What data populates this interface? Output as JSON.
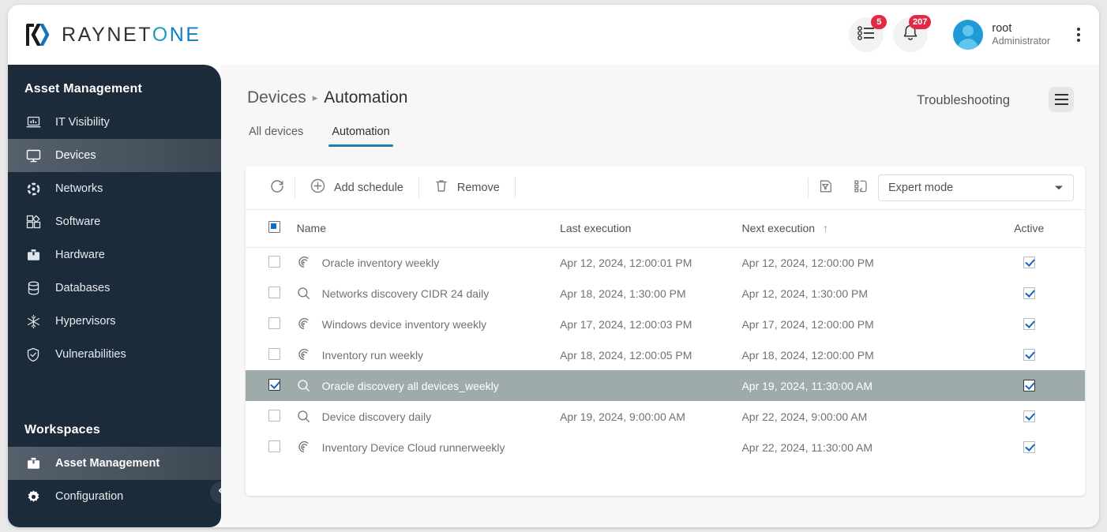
{
  "brand": {
    "name_dark": "RAYNET",
    "name_o": "O",
    "name_ne": "NE",
    "logo_icon": "raynet-logo-icon"
  },
  "topbar": {
    "tasks": {
      "icon": "task-list-icon",
      "badge": "5"
    },
    "notifications": {
      "icon": "bell-icon",
      "badge": "207"
    },
    "user": {
      "name": "root",
      "role": "Administrator",
      "avatar_icon": "user-avatar-icon"
    },
    "overflow_icon": "kebab-menu-icon"
  },
  "sidebar": {
    "section_title": "Asset Management",
    "items": [
      {
        "label": "IT Visibility",
        "icon": "laptop-chart-icon",
        "active": false
      },
      {
        "label": "Devices",
        "icon": "monitor-icon",
        "active": true
      },
      {
        "label": "Networks",
        "icon": "network-nodes-icon",
        "active": false
      },
      {
        "label": "Software",
        "icon": "software-blocks-icon",
        "active": false
      },
      {
        "label": "Hardware",
        "icon": "toolbox-icon",
        "active": false
      },
      {
        "label": "Databases",
        "icon": "database-icon",
        "active": false
      },
      {
        "label": "Hypervisors",
        "icon": "snowflake-icon",
        "active": false
      },
      {
        "label": "Vulnerabilities",
        "icon": "shield-check-icon",
        "active": false
      }
    ],
    "workspaces_title": "Workspaces",
    "workspaces": [
      {
        "label": "Asset Management",
        "icon": "briefcase-icon",
        "active": true
      },
      {
        "label": "Configuration",
        "icon": "gear-icon",
        "active": false
      }
    ],
    "collapse_icon": "chevron-left-icon"
  },
  "main": {
    "breadcrumb": {
      "root": "Devices",
      "separator": "▸",
      "current": "Automation"
    },
    "troubleshooting_label": "Troubleshooting",
    "menu_icon": "hamburger-menu-icon",
    "tabs": [
      {
        "label": "All devices",
        "active": false
      },
      {
        "label": "Automation",
        "active": true
      }
    ]
  },
  "toolbar": {
    "refresh_icon": "refresh-icon",
    "add_schedule_label": "Add schedule",
    "add_schedule_icon": "plus-circle-icon",
    "remove_label": "Remove",
    "remove_icon": "trash-icon",
    "filter_icon": "filter-document-icon",
    "columns_icon": "column-settings-icon",
    "mode_select": {
      "value": "Expert mode",
      "caret_icon": "chevron-down-icon"
    }
  },
  "table": {
    "header_checkbox_state": "indeterminate",
    "columns": [
      {
        "key": "name",
        "label": "Name"
      },
      {
        "key": "last",
        "label": "Last execution"
      },
      {
        "key": "next",
        "label": "Next execution",
        "sort": "↑"
      },
      {
        "key": "active",
        "label": "Active"
      }
    ],
    "rows": [
      {
        "selected": false,
        "checked": false,
        "icon": "inventory-scan-icon",
        "name": "Oracle inventory weekly",
        "last": "Apr 12, 2024, 12:00:01 PM",
        "next": "Apr 12, 2024, 12:00:00 PM",
        "active": true
      },
      {
        "selected": false,
        "checked": false,
        "icon": "search-icon",
        "name": "Networks discovery CIDR 24 daily",
        "last": "Apr 18, 2024, 1:30:00 PM",
        "next": "Apr 12, 2024, 1:30:00 PM",
        "active": true
      },
      {
        "selected": false,
        "checked": false,
        "icon": "inventory-scan-icon",
        "name": "Windows device inventory weekly",
        "last": "Apr 17, 2024, 12:00:03 PM",
        "next": "Apr 17, 2024, 12:00:00 PM",
        "active": true
      },
      {
        "selected": false,
        "checked": false,
        "icon": "inventory-scan-icon",
        "name": "Inventory run weekly",
        "last": "Apr 18, 2024, 12:00:05 PM",
        "next": "Apr 18, 2024, 12:00:00 PM",
        "active": true
      },
      {
        "selected": true,
        "checked": true,
        "icon": "search-icon",
        "name": "Oracle discovery all devices_weekly",
        "last": "",
        "next": "Apr 19, 2024, 11:30:00 AM",
        "active": true
      },
      {
        "selected": false,
        "checked": false,
        "icon": "search-icon",
        "name": "Device discovery daily",
        "last": "Apr 19, 2024, 9:00:00 AM",
        "next": "Apr 22, 2024, 9:00:00 AM",
        "active": true
      },
      {
        "selected": false,
        "checked": false,
        "icon": "inventory-scan-icon",
        "name": "Inventory Device Cloud runnerweekly",
        "last": "",
        "next": "Apr 22, 2024, 11:30:00 AM",
        "active": true
      }
    ]
  },
  "colors": {
    "sidebar_bg": "#1c2b3a",
    "accent_blue": "#1b7fb5",
    "badge_red": "#e02b45",
    "selected_row": "#9fabab",
    "checkbox_blue": "#1565c0"
  }
}
